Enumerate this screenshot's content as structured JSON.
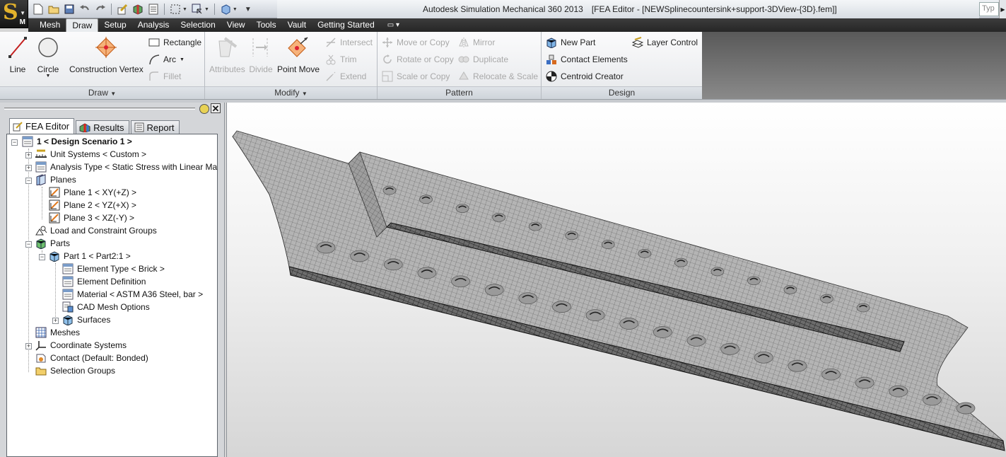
{
  "title_bar": {
    "app_title": "Autodesk Simulation Mechanical 360 2013",
    "document": "[FEA Editor - [NEWSplinecountersink+support-3DView-{3D}.fem]]",
    "search_placeholder": "Typ",
    "app_letter": "S",
    "app_sub": "M"
  },
  "menu_tabs": [
    "Mesh",
    "Draw",
    "Setup",
    "Analysis",
    "Selection",
    "View",
    "Tools",
    "Vault",
    "Getting Started"
  ],
  "active_tab": "Draw",
  "ribbon": {
    "draw": {
      "label": "Draw",
      "line": "Line",
      "circle": "Circle",
      "construction_vertex": "Construction Vertex",
      "rectangle": "Rectangle",
      "arc": "Arc",
      "fillet": "Fillet"
    },
    "modify": {
      "label": "Modify",
      "attributes": "Attributes",
      "divide": "Divide",
      "point_move": "Point Move",
      "intersect": "Intersect",
      "trim": "Trim",
      "extend": "Extend"
    },
    "pattern": {
      "label": "Pattern",
      "move_or_copy": "Move or Copy",
      "rotate_or_copy": "Rotate or Copy",
      "scale_or_copy": "Scale or Copy",
      "mirror": "Mirror",
      "duplicate": "Duplicate",
      "relocate_scale": "Relocate & Scale"
    },
    "design": {
      "label": "Design",
      "new_part": "New Part",
      "contact_elements": "Contact Elements",
      "centroid_creator": "Centroid Creator",
      "layer_control": "Layer Control"
    }
  },
  "browser": {
    "tabs": [
      "FEA Editor",
      "Results",
      "Report"
    ],
    "tree": {
      "scenario": "1 < Design Scenario 1 >",
      "unit_systems": "Unit Systems < Custom >",
      "analysis_type": "Analysis Type < Static Stress with Linear Ma",
      "planes": "Planes",
      "plane1": "Plane 1 < XY(+Z) >",
      "plane2": "Plane 2 < YZ(+X) >",
      "plane3": "Plane 3 < XZ(-Y) >",
      "load_groups": "Load and Constraint Groups",
      "parts": "Parts",
      "part1": "Part 1 < Part2:1 >",
      "element_type": "Element Type < Brick >",
      "element_definition": "Element Definition",
      "material": "Material < ASTM A36 Steel, bar >",
      "cad_mesh_options": "CAD Mesh Options",
      "surfaces": "Surfaces",
      "meshes": "Meshes",
      "coordinate_systems": "Coordinate Systems",
      "contact": "Contact (Default: Bonded)",
      "selection_groups": "Selection Groups"
    }
  },
  "colors": {
    "ribbon_bg": "#f4f5f7",
    "menubar_bg": "#2e2e2e",
    "mesh_fill": "#a9a9a9",
    "mesh_edge": "#3a3a3a",
    "logo": "#e3b22b"
  }
}
